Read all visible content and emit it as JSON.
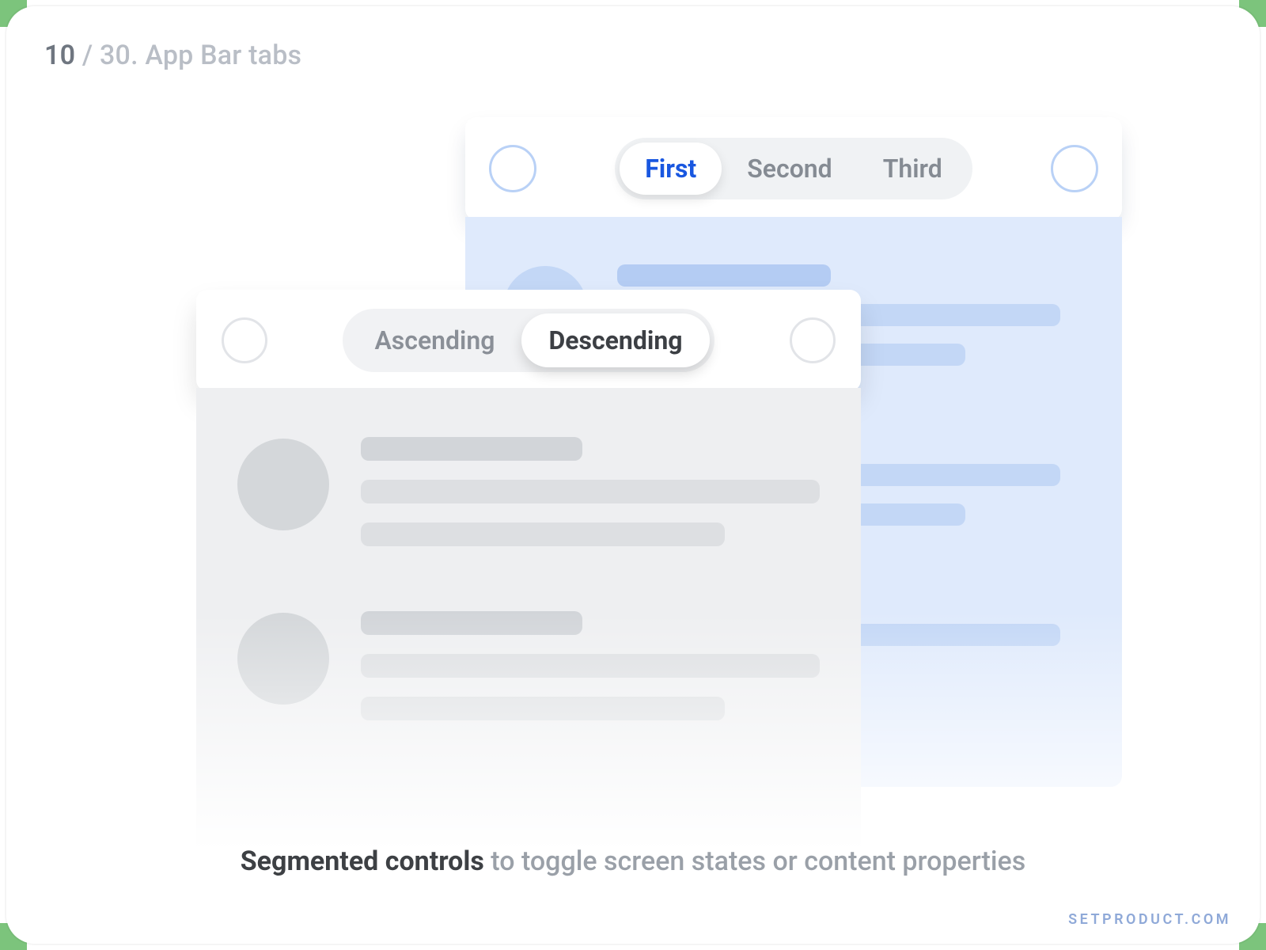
{
  "breadcrumb": {
    "current": "10",
    "separator": " / ",
    "total_and_title": "30. App Bar tabs"
  },
  "blue_card": {
    "segments": [
      "First",
      "Second",
      "Third"
    ],
    "active_index": 0
  },
  "gray_card": {
    "segments": [
      "Ascending",
      "Descending"
    ],
    "active_index": 1
  },
  "caption": {
    "strong": "Segmented controls",
    "rest": " to toggle screen states or content properties"
  },
  "watermark": "SETPRODUCT.COM"
}
